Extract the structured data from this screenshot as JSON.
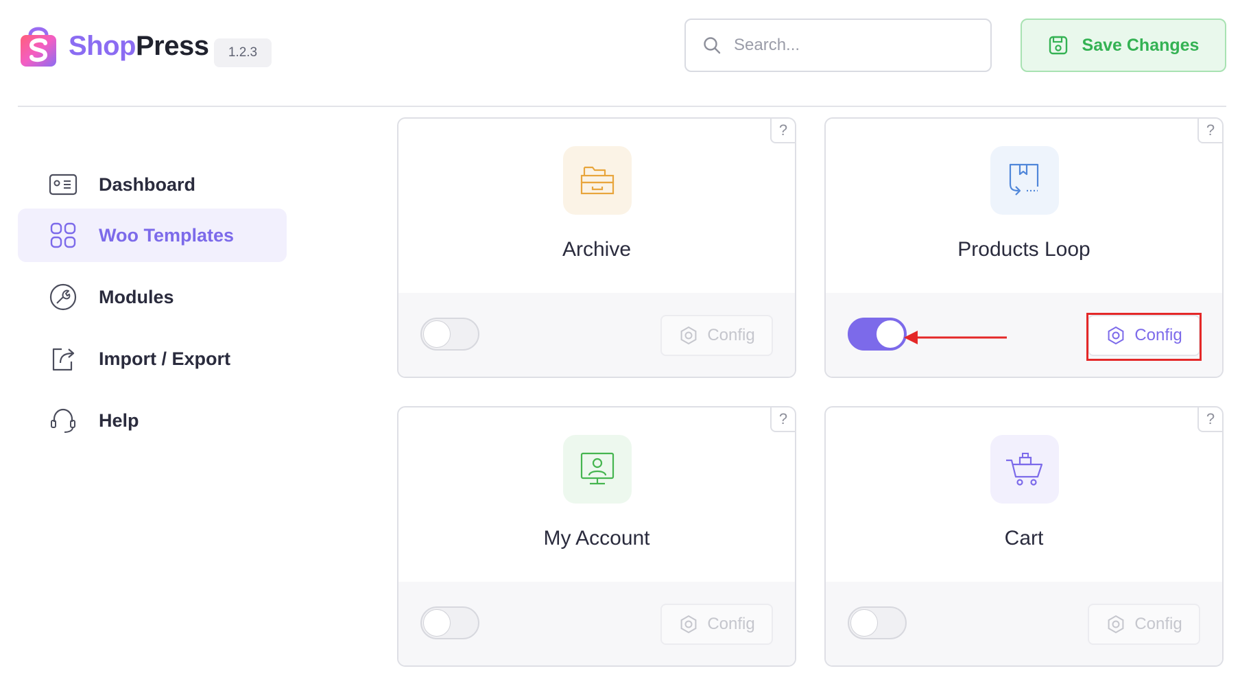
{
  "header": {
    "brand_part1": "Shop",
    "brand_part2": "Press",
    "version": "1.2.3",
    "search_placeholder": "Search...",
    "save_label": "Save Changes"
  },
  "sidebar": {
    "items": [
      {
        "label": "Dashboard",
        "icon": "id-card-icon",
        "active": false
      },
      {
        "label": "Woo Templates",
        "icon": "grid-icon",
        "active": true
      },
      {
        "label": "Modules",
        "icon": "modules-wrench-icon",
        "active": false
      },
      {
        "label": "Import / Export",
        "icon": "share-export-icon",
        "active": false
      },
      {
        "label": "Help",
        "icon": "headset-icon",
        "active": false
      }
    ]
  },
  "cards": [
    {
      "title": "Archive",
      "icon": "archive-box-icon",
      "accent": "#e8a53c",
      "enabled": false,
      "config_label": "Config",
      "help": "?"
    },
    {
      "title": "Products Loop",
      "icon": "products-loop-icon",
      "accent": "#4f86d9",
      "enabled": true,
      "config_label": "Config",
      "help": "?"
    },
    {
      "title": "My Account",
      "icon": "account-monitor-icon",
      "accent": "#45b54f",
      "enabled": false,
      "config_label": "Config",
      "help": "?"
    },
    {
      "title": "Cart",
      "icon": "cart-icon",
      "accent": "#7c6aea",
      "enabled": false,
      "config_label": "Config",
      "help": "?"
    }
  ],
  "colors": {
    "primary": "#7c6aea",
    "save_green": "#34b253",
    "annotation_red": "#e42828"
  }
}
